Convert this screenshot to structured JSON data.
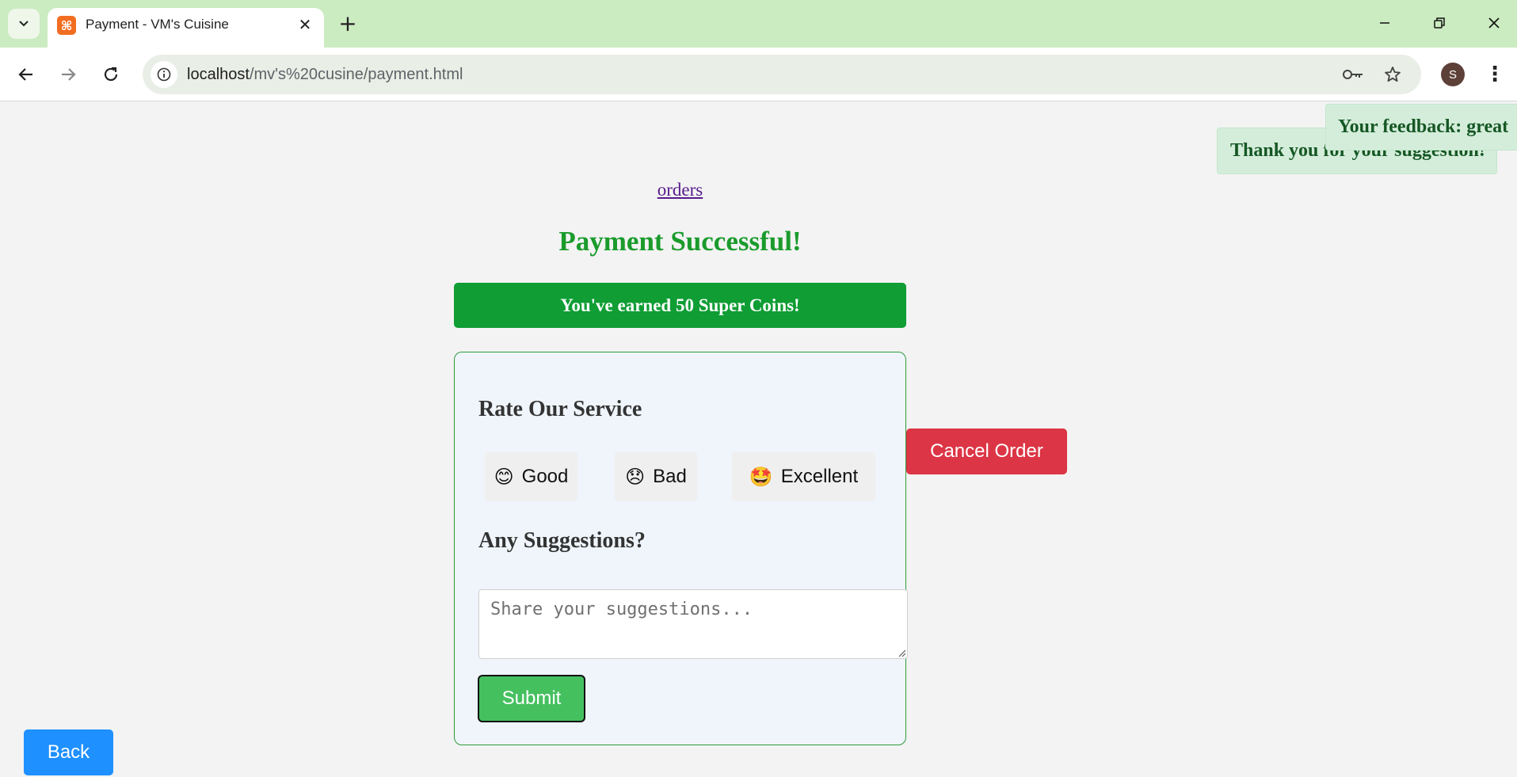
{
  "browser": {
    "tab_title": "Payment - VM's Cuisine",
    "favicon_glyph": "⌘",
    "url_host": "localhost",
    "url_path": "/mv's%20cusine/payment.html",
    "profile_initial": "S"
  },
  "page": {
    "orders_link": "orders",
    "headline": "Payment Successful!",
    "coins_banner": "You've earned 50 Super Coins!",
    "rating": {
      "title": "Rate Our Service",
      "options": [
        {
          "emoji": "😊",
          "label": "Good"
        },
        {
          "emoji": "😞",
          "label": "Bad"
        },
        {
          "emoji": "🤩",
          "label": "Excellent"
        }
      ]
    },
    "suggestions": {
      "title": "Any Suggestions?",
      "placeholder": "Share your suggestions...",
      "submit_label": "Submit"
    },
    "cancel_label": "Cancel Order",
    "back_label": "Back"
  },
  "toasts": {
    "suggestion": "Thank you for your suggestion!",
    "feedback": "Your feedback: great"
  },
  "colors": {
    "tab_strip": "#cbebc0",
    "success_green": "#1a9b2c",
    "coins_banner": "#0f9d34",
    "submit_green": "#45c05f",
    "cancel_red": "#dc3545",
    "back_blue": "#1e90ff",
    "toast_bg": "#d4edda",
    "toast_text": "#155724"
  }
}
